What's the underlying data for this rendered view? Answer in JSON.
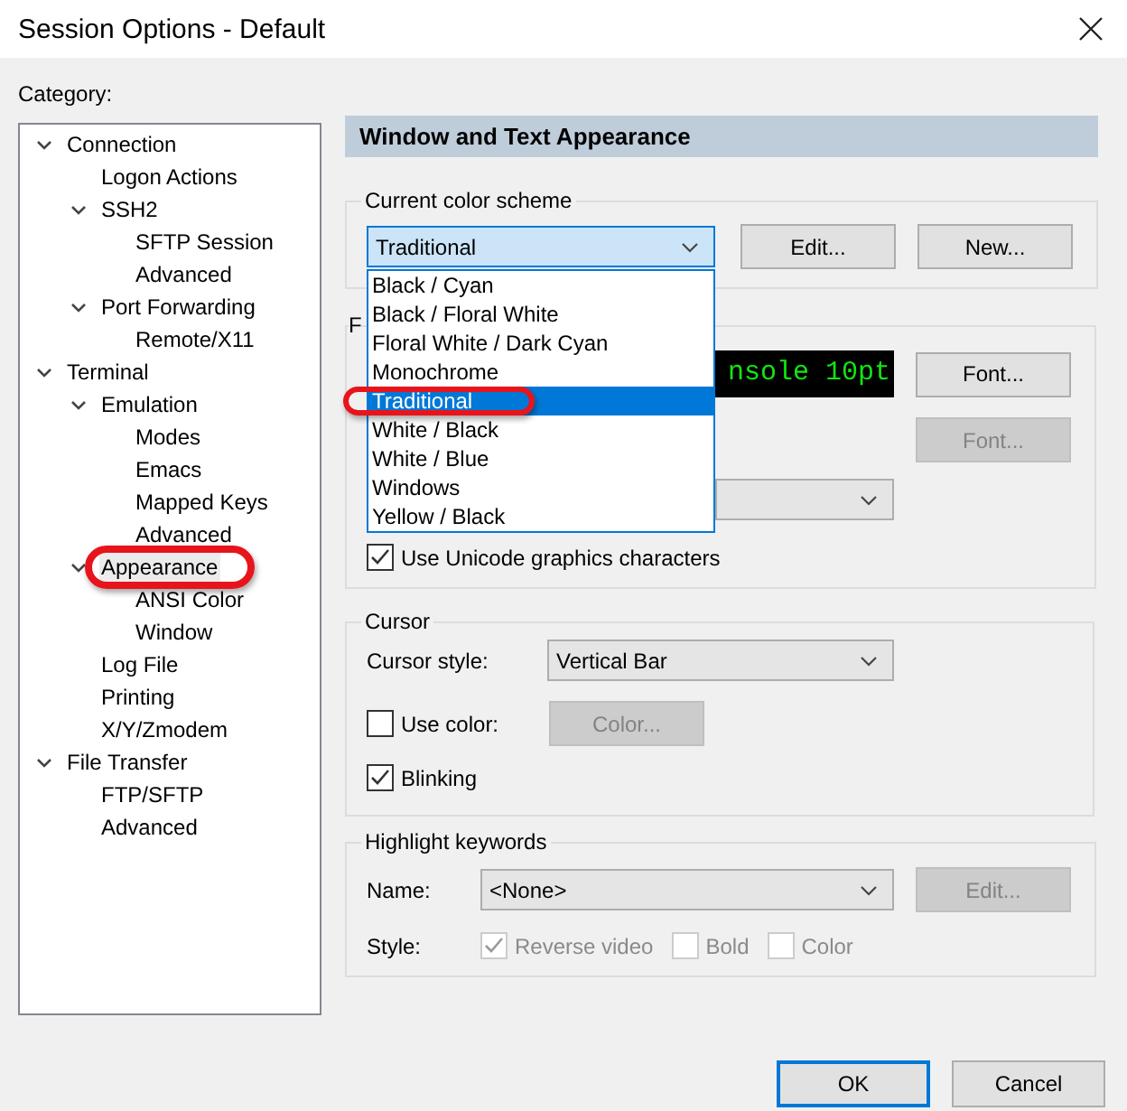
{
  "window": {
    "title": "Session Options - Default"
  },
  "category": {
    "label": "Category:",
    "tree": [
      {
        "label": "Connection",
        "selected": false,
        "circled": false,
        "expanded": true,
        "children": [
          {
            "label": "Logon Actions",
            "selected": false,
            "circled": false
          },
          {
            "label": "SSH2",
            "selected": false,
            "circled": false,
            "expanded": true,
            "children": [
              {
                "label": "SFTP Session",
                "selected": false,
                "circled": false
              },
              {
                "label": "Advanced",
                "selected": false,
                "circled": false
              }
            ]
          },
          {
            "label": "Port Forwarding",
            "selected": false,
            "circled": false,
            "expanded": true,
            "children": [
              {
                "label": "Remote/X11",
                "selected": false,
                "circled": false
              }
            ]
          }
        ]
      },
      {
        "label": "Terminal",
        "selected": false,
        "circled": false,
        "expanded": true,
        "children": [
          {
            "label": "Emulation",
            "selected": false,
            "circled": false,
            "expanded": true,
            "children": [
              {
                "label": "Modes",
                "selected": false,
                "circled": false
              },
              {
                "label": "Emacs",
                "selected": false,
                "circled": false
              },
              {
                "label": "Mapped Keys",
                "selected": false,
                "circled": false
              },
              {
                "label": "Advanced",
                "selected": false,
                "circled": false
              }
            ]
          },
          {
            "label": "Appearance",
            "selected": true,
            "circled": true,
            "expanded": true,
            "children": [
              {
                "label": "ANSI Color",
                "selected": false,
                "circled": false
              },
              {
                "label": "Window",
                "selected": false,
                "circled": false
              }
            ]
          },
          {
            "label": "Log File",
            "selected": false,
            "circled": false
          },
          {
            "label": "Printing",
            "selected": false,
            "circled": false
          },
          {
            "label": "X/Y/Zmodem",
            "selected": false,
            "circled": false
          }
        ]
      },
      {
        "label": "File Transfer",
        "selected": false,
        "circled": false,
        "expanded": true,
        "children": [
          {
            "label": "FTP/SFTP",
            "selected": false,
            "circled": false
          },
          {
            "label": "Advanced",
            "selected": false,
            "circled": false
          }
        ]
      }
    ]
  },
  "panel": {
    "header": "Window and Text Appearance",
    "color_scheme": {
      "legend": "Current color scheme",
      "value": "Traditional",
      "open": true,
      "options": [
        {
          "label": "Black / Cyan",
          "selected": false,
          "circled": false
        },
        {
          "label": "Black / Floral White",
          "selected": false,
          "circled": false
        },
        {
          "label": "Floral White / Dark Cyan",
          "selected": false,
          "circled": false
        },
        {
          "label": "Monochrome",
          "selected": false,
          "circled": false
        },
        {
          "label": "Traditional",
          "selected": true,
          "circled": true
        },
        {
          "label": "White / Black",
          "selected": false,
          "circled": false
        },
        {
          "label": "White / Blue",
          "selected": false,
          "circled": false
        },
        {
          "label": "Windows",
          "selected": false,
          "circled": false
        },
        {
          "label": "Yellow / Black",
          "selected": false,
          "circled": false
        }
      ],
      "buttons": [
        {
          "label": "Edit...",
          "disabled": false
        },
        {
          "label": "New...",
          "disabled": false
        }
      ]
    },
    "fonts": {
      "legend": "F",
      "preview": "nsole 10pt",
      "font_button": {
        "label": "Font...",
        "disabled": false
      },
      "second_font_button": {
        "label": "Font...",
        "disabled": true
      },
      "unicode": {
        "label": "Use Unicode graphics characters",
        "checked": true,
        "disabled": false
      }
    },
    "cursor": {
      "legend": "Cursor",
      "style_label": "Cursor style:",
      "style_value": "Vertical Bar",
      "use_color": {
        "label": "Use color:",
        "checked": false,
        "disabled": false
      },
      "color_button": {
        "label": "Color...",
        "disabled": true
      },
      "blinking": {
        "label": "Blinking",
        "checked": true,
        "disabled": false
      }
    },
    "highlight": {
      "legend": "Highlight keywords",
      "name_label": "Name:",
      "name_value": "<None>",
      "edit_button": {
        "label": "Edit...",
        "disabled": true
      },
      "style_label": "Style:",
      "styles": [
        {
          "label": "Reverse video",
          "checked": true,
          "disabled": true
        },
        {
          "label": "Bold",
          "checked": false,
          "disabled": true
        },
        {
          "label": "Color",
          "checked": false,
          "disabled": true
        }
      ]
    }
  },
  "footer": {
    "buttons": [
      {
        "label": "OK",
        "default": true
      },
      {
        "label": "Cancel",
        "default": false
      }
    ]
  }
}
